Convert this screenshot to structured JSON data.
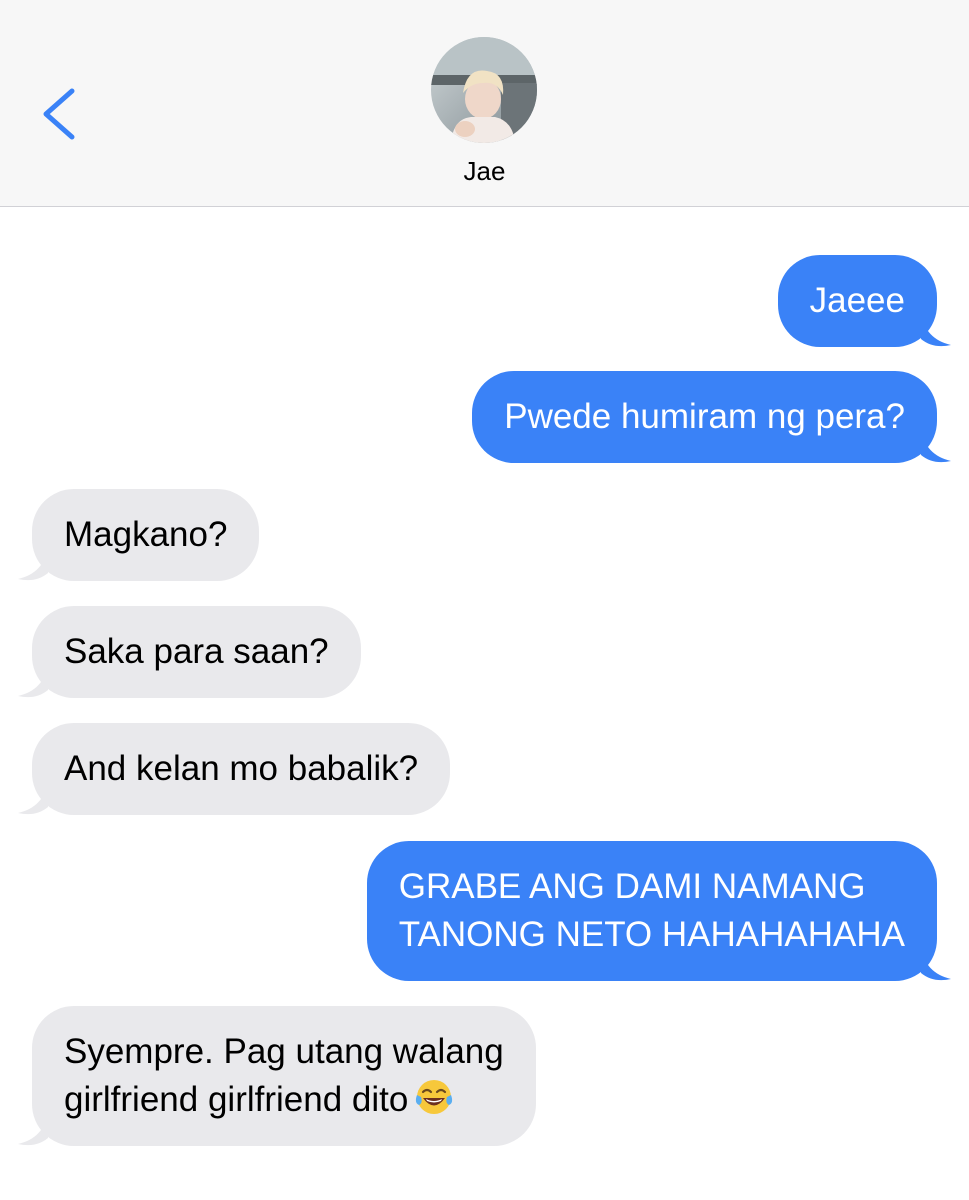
{
  "header": {
    "contact_name": "Jae",
    "back_icon": "chevron-left-icon",
    "avatar_icon": "contact-photo"
  },
  "colors": {
    "accent": "#3a82f7",
    "sent_bubble": "#3a82f7",
    "received_bubble": "#e9e9ec",
    "header_bg": "#f7f7f7"
  },
  "messages": [
    {
      "direction": "sent",
      "lines": [
        "Jaeee"
      ]
    },
    {
      "direction": "sent",
      "lines": [
        "Pwede humiram ng pera?"
      ]
    },
    {
      "direction": "received",
      "lines": [
        "Magkano?"
      ]
    },
    {
      "direction": "received",
      "lines": [
        "Saka para saan?"
      ]
    },
    {
      "direction": "received",
      "lines": [
        "And kelan mo babalik?"
      ]
    },
    {
      "direction": "sent",
      "lines": [
        "GRABE ANG DAMI NAMANG",
        "TANONG NETO HAHAHAHAHA"
      ]
    },
    {
      "direction": "received",
      "lines": [
        "Syempre. Pag utang walang",
        "girlfriend girlfriend dito"
      ],
      "emoji": "face-with-tears-of-joy-icon"
    }
  ]
}
